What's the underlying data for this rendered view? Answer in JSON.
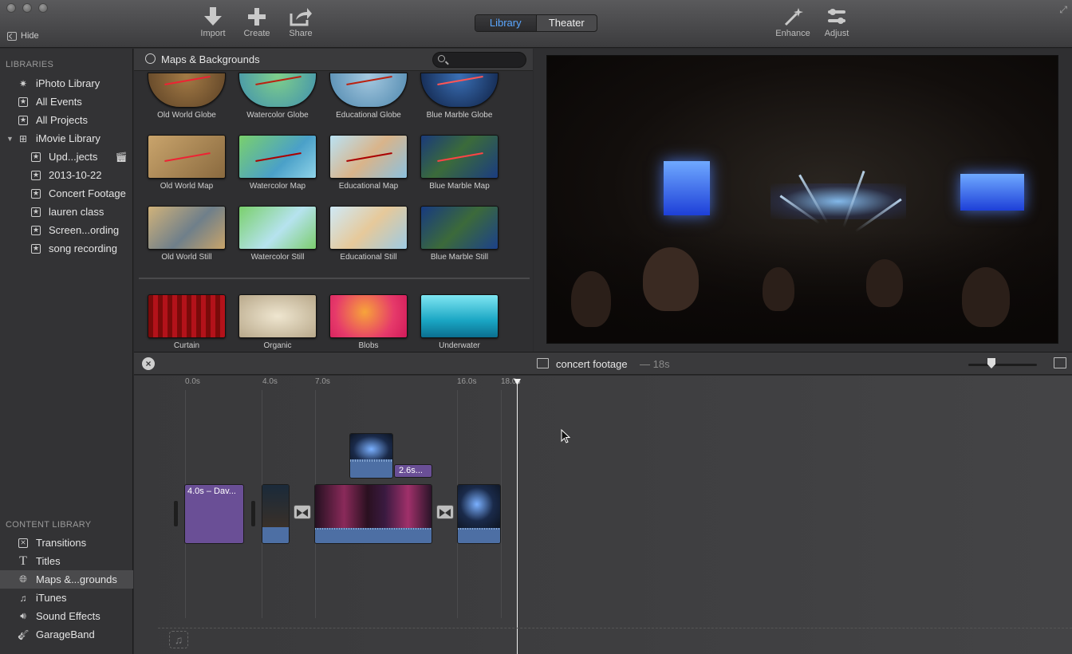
{
  "toolbar": {
    "hide_label": "Hide",
    "import_label": "Import",
    "create_label": "Create",
    "share_label": "Share",
    "view_toggle": {
      "library": "Library",
      "theater": "Theater",
      "selected": "Library"
    },
    "enhance_label": "Enhance",
    "adjust_label": "Adjust"
  },
  "sidebar": {
    "libraries_title": "LIBRARIES",
    "libraries": [
      {
        "label": "iPhoto Library",
        "icon": "star-burst-icon"
      },
      {
        "label": "All Events",
        "icon": "star-icon"
      },
      {
        "label": "All Projects",
        "icon": "star-icon"
      },
      {
        "label": "iMovie Library",
        "icon": "grid-icon",
        "expanded": true
      },
      {
        "label": "Upd...jects",
        "icon": "star-icon"
      },
      {
        "label": "2013-10-22",
        "icon": "star-icon"
      },
      {
        "label": "Concert Footage",
        "icon": "star-icon"
      },
      {
        "label": "lauren class",
        "icon": "star-icon"
      },
      {
        "label": "Screen...ording",
        "icon": "star-icon"
      },
      {
        "label": "song recording",
        "icon": "star-icon"
      }
    ],
    "content_title": "CONTENT LIBRARY",
    "content": [
      {
        "label": "Transitions",
        "icon": "transitions-icon"
      },
      {
        "label": "Titles",
        "icon": "titles-icon"
      },
      {
        "label": "Maps &...grounds",
        "icon": "globe-icon",
        "selected": true
      },
      {
        "label": "iTunes",
        "icon": "music-note-icon"
      },
      {
        "label": "Sound Effects",
        "icon": "speaker-icon"
      },
      {
        "label": "GarageBand",
        "icon": "guitar-icon"
      }
    ]
  },
  "browser": {
    "title": "Maps & Backgrounds",
    "search_placeholder": "",
    "rows": [
      [
        "Old World Globe",
        "Watercolor Globe",
        "Educational Globe",
        "Blue Marble Globe"
      ],
      [
        "Old World Map",
        "Watercolor Map",
        "Educational Map",
        "Blue Marble Map"
      ],
      [
        "Old World Still",
        "Watercolor Still",
        "Educational Still",
        "Blue Marble Still"
      ],
      [
        "Curtain",
        "Organic",
        "Blobs",
        "Underwater"
      ]
    ]
  },
  "timeline": {
    "project_title": "concert footage",
    "duration": "— 18s",
    "ticks": [
      "0.0s",
      "4.0s",
      "7.0s",
      "16.0s",
      "18.0s"
    ],
    "title_clip_label": "4.0s – Dav...",
    "cutaway_label": "2.6s..."
  },
  "colors": {
    "accent": "#5aa6ff",
    "title_clip": "#6a4f96",
    "audio": "#4d6fa4"
  }
}
